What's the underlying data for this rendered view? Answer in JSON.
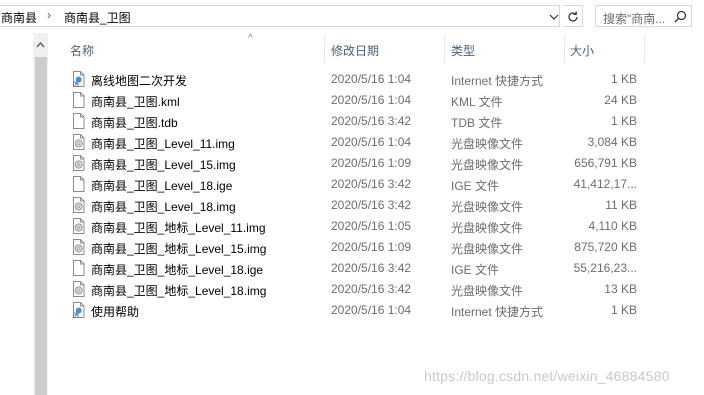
{
  "breadcrumb": {
    "parent": "商南县",
    "current": "商南县_卫图"
  },
  "search": {
    "placeholder": "搜索\"商南..."
  },
  "columns": {
    "name": "名称",
    "date": "修改日期",
    "type": "类型",
    "size": "大小"
  },
  "files": [
    {
      "name": "离线地图二次开发",
      "date": "2020/5/16 1:04",
      "type": "Internet 快捷方式",
      "size": "1 KB",
      "icon": "shortcut-icon"
    },
    {
      "name": "商南县_卫图.kml",
      "date": "2020/5/16 1:04",
      "type": "KML 文件",
      "size": "24 KB",
      "icon": "file-icon"
    },
    {
      "name": "商南县_卫图.tdb",
      "date": "2020/5/16 3:42",
      "type": "TDB 文件",
      "size": "1 KB",
      "icon": "file-icon"
    },
    {
      "name": "商南县_卫图_Level_11.img",
      "date": "2020/5/16 1:04",
      "type": "光盘映像文件",
      "size": "3,084 KB",
      "icon": "disc-image-icon"
    },
    {
      "name": "商南县_卫图_Level_15.img",
      "date": "2020/5/16 1:09",
      "type": "光盘映像文件",
      "size": "656,791 KB",
      "icon": "disc-image-icon"
    },
    {
      "name": "商南县_卫图_Level_18.ige",
      "date": "2020/5/16 3:42",
      "type": "IGE 文件",
      "size": "41,412,17...",
      "icon": "file-icon"
    },
    {
      "name": "商南县_卫图_Level_18.img",
      "date": "2020/5/16 3:42",
      "type": "光盘映像文件",
      "size": "11 KB",
      "icon": "disc-image-icon"
    },
    {
      "name": "商南县_卫图_地标_Level_11.img",
      "date": "2020/5/16 1:05",
      "type": "光盘映像文件",
      "size": "4,110 KB",
      "icon": "disc-image-icon"
    },
    {
      "name": "商南县_卫图_地标_Level_15.img",
      "date": "2020/5/16 1:09",
      "type": "光盘映像文件",
      "size": "875,720 KB",
      "icon": "disc-image-icon"
    },
    {
      "name": "商南县_卫图_地标_Level_18.ige",
      "date": "2020/5/16 3:42",
      "type": "IGE 文件",
      "size": "55,216,23...",
      "icon": "file-icon"
    },
    {
      "name": "商南县_卫图_地标_Level_18.img",
      "date": "2020/5/16 3:42",
      "type": "光盘映像文件",
      "size": "13 KB",
      "icon": "disc-image-icon"
    },
    {
      "name": "使用帮助",
      "date": "2020/5/16 1:04",
      "type": "Internet 快捷方式",
      "size": "1 KB",
      "icon": "shortcut-icon"
    }
  ],
  "watermark": "https://blog.csdn.net/weixin_46884580"
}
